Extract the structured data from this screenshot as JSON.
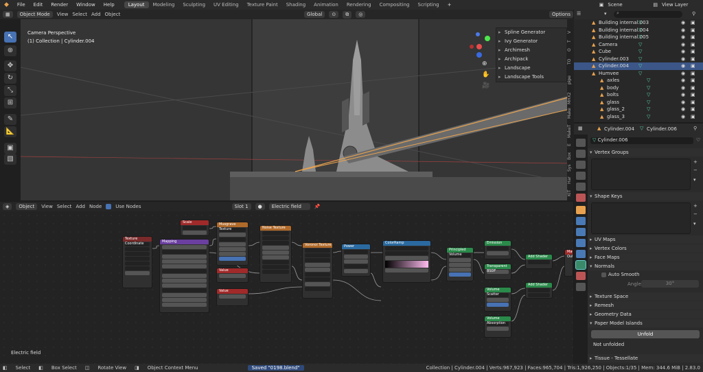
{
  "topbar": {
    "menus": [
      "File",
      "Edit",
      "Render",
      "Window",
      "Help"
    ],
    "workspaces": [
      "Layout",
      "Modeling",
      "Sculpting",
      "UV Editing",
      "Texture Paint",
      "Shading",
      "Animation",
      "Rendering",
      "Compositing",
      "Scripting"
    ],
    "active_workspace": "Layout",
    "scene": "Scene",
    "view_layer": "View Layer"
  },
  "viewport_header": {
    "mode": "Object Mode",
    "menus": [
      "View",
      "Select",
      "Add",
      "Object"
    ],
    "transform": "Global",
    "options": "Options"
  },
  "viewport": {
    "title": "Camera Perspective",
    "subtitle": "(1) Collection | Cylinder.004"
  },
  "addon_panel": {
    "items": [
      "Spline Generator",
      "Ivy Generator",
      "Archimesh",
      "Archipack",
      "Landscape",
      "Landscape Tools"
    ]
  },
  "n_tabs": [
    "V",
    "T",
    "O",
    "TO",
    "pipe",
    "MHX2",
    "Make",
    "MakeT",
    "E",
    "Box",
    "Sys",
    "Har",
    "KIT"
  ],
  "node_header": {
    "type": "Object",
    "menus": [
      "View",
      "Select",
      "Add",
      "Node"
    ],
    "use_nodes": "Use Nodes",
    "slot": "Slot 1",
    "material": "Electric field"
  },
  "node_editor": {
    "label": "Electric field",
    "nodes": {
      "texcoord": "Texture Coordinate",
      "mapping": "Mapping",
      "scale": "Scale",
      "musgrave": "Musgrave Texture",
      "noise": "Noise Texture",
      "value1": "Value",
      "value2": "Value",
      "voronoi": "Voronoi Texture",
      "power": "Power",
      "colorramp": "ColorRamp",
      "principled_vol": "Principled Volume",
      "emission": "Emission",
      "transparent": "Transparent BSDF",
      "add_shader1": "Add Shader",
      "add_shader2": "Add Shader",
      "vol_scatter": "Volume Scatter",
      "vol_absorb": "Volume Absorption",
      "output": "Material Output"
    }
  },
  "statusbar": {
    "select": "Select",
    "box_select": "Box Select",
    "rotate": "Rotate View",
    "context": "Object Context Menu",
    "saved": "Saved \"0198.blend\"",
    "stats": "Collection | Cylinder.004 | Verts:967,923 | Faces:965,704 | Tris:1,926,250 | Objects:1/35 | Mem: 344.6 MiB | 2.83.0"
  },
  "outliner": {
    "rows": [
      {
        "name": "Building internal.003",
        "indent": 2
      },
      {
        "name": "Building internal.004",
        "indent": 2
      },
      {
        "name": "Building internal.005",
        "indent": 2
      },
      {
        "name": "Camera",
        "indent": 2
      },
      {
        "name": "Cube",
        "indent": 2
      },
      {
        "name": "Cylinder.003",
        "indent": 2
      },
      {
        "name": "Cylinder.004",
        "indent": 2,
        "selected": true
      },
      {
        "name": "Humvee",
        "indent": 2
      },
      {
        "name": "axles",
        "indent": 3
      },
      {
        "name": "body",
        "indent": 3
      },
      {
        "name": "bolts",
        "indent": 3
      },
      {
        "name": "glass",
        "indent": 3
      },
      {
        "name": "glass_2",
        "indent": 3
      },
      {
        "name": "glass_3",
        "indent": 3
      }
    ]
  },
  "properties": {
    "object": "Cylinder.004",
    "mesh": "Cylinder.006",
    "datablock": "Cylinder.006",
    "sections": {
      "vertex_groups": "Vertex Groups",
      "shape_keys": "Shape Keys",
      "uv_maps": "UV Maps",
      "vertex_colors": "Vertex Colors",
      "face_maps": "Face Maps",
      "normals": "Normals",
      "auto_smooth": "Auto Smooth",
      "angle_label": "Angle",
      "angle_value": "30°",
      "texture_space": "Texture Space",
      "remesh": "Remesh",
      "geometry_data": "Geometry Data",
      "paper_model": "Paper Model Islands",
      "unfold": "Unfold",
      "not_unfolded": "Not unfolded",
      "tissue": "Tissue - Tessellate"
    }
  },
  "colors": {
    "accent": "#4772b3",
    "selected_row": "#3b5687",
    "object_orange": "#e8a24f"
  }
}
